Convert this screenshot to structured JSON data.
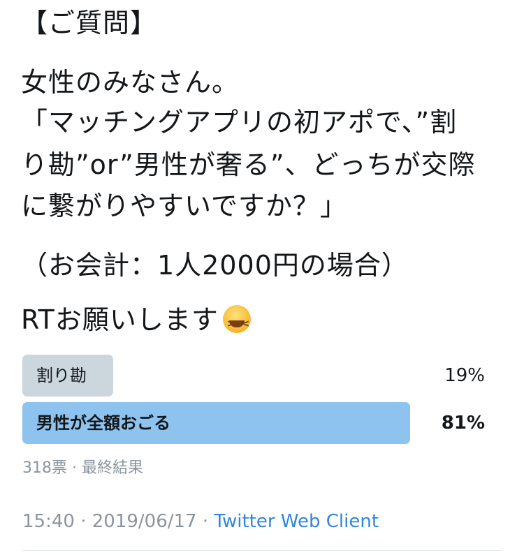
{
  "tweet": {
    "lines": [
      "【ご質問】",
      "女性のみなさん。",
      "「マッチングアプリの初アポで、”割",
      "り勘”or”男性が奢る”、どっちが交際",
      "に繋がりやすいですか？」",
      "（お会計：1人2000円の場合）",
      "RTお願いします"
    ],
    "emoji": "grinning-squinting-face"
  },
  "poll": {
    "options": [
      {
        "label": "割り勘",
        "percent": "19%",
        "fraction": 0.19,
        "color": "#ccd6dd",
        "winner": false
      },
      {
        "label": "男性が全額おごる",
        "percent": "81%",
        "fraction": 0.81,
        "color": "#8ec3f0",
        "winner": true
      }
    ],
    "votes": "318票",
    "status": "最終結果",
    "separator": "·"
  },
  "footer": {
    "time": "15:40",
    "date": "2019/06/17",
    "separator": "·",
    "client": "Twitter Web Client"
  }
}
